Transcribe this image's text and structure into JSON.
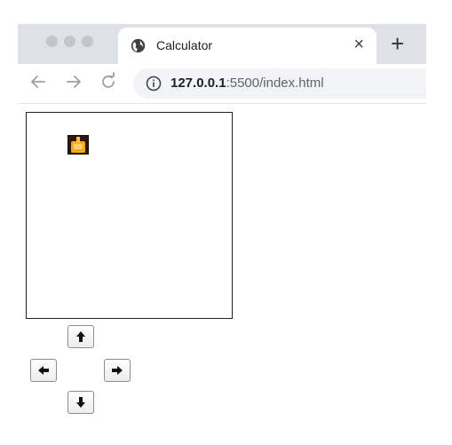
{
  "browser": {
    "tab_title": "Calculator",
    "tab_close": "×",
    "new_tab": "+",
    "url_host": "127.0.0.1",
    "url_rest": ":5500/index.html"
  },
  "controls": {
    "up": "up-arrow-icon",
    "down": "down-arrow-icon",
    "left": "left-arrow-icon",
    "right": "right-arrow-icon"
  },
  "colors": {
    "player_fill": "#f5a623",
    "player_bg": "#2b1a05",
    "board_border": "#222222"
  }
}
